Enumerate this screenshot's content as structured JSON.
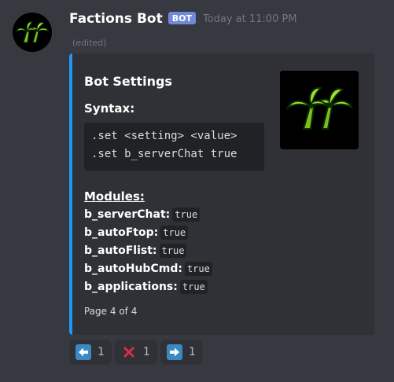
{
  "message": {
    "author": "Factions Bot",
    "bot_tag": "BOT",
    "timestamp": "Today at 11:00 PM",
    "edited": "(edited)",
    "avatar_icon": "palm-trees-logo"
  },
  "embed": {
    "accent_color": "#2196f3",
    "title": "Bot Settings",
    "thumbnail_icon": "palm-trees-logo",
    "syntax_label": "Syntax:",
    "code_lines": [
      ".set <setting> <value>",
      ".set b_serverChat true"
    ],
    "modules_label": "Modules:",
    "modules": [
      {
        "key": "b_serverChat:",
        "value": "true"
      },
      {
        "key": "b_autoFtop:",
        "value": "true"
      },
      {
        "key": "b_autoFlist:",
        "value": "true"
      },
      {
        "key": "b_autoHubCmd:",
        "value": "true"
      },
      {
        "key": "b_applications:",
        "value": "true"
      }
    ],
    "footer": "Page 4 of 4"
  },
  "reactions": [
    {
      "icon": "arrow-left-icon",
      "count": "1"
    },
    {
      "icon": "cross-mark-icon",
      "count": "1"
    },
    {
      "icon": "arrow-right-icon",
      "count": "1"
    }
  ]
}
